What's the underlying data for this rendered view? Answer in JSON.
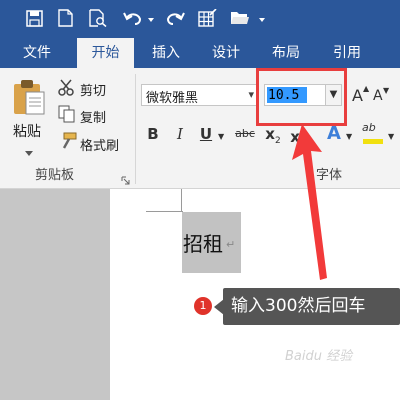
{
  "quick_access": {
    "icons": [
      "save-icon",
      "new-document-icon",
      "print-preview-icon",
      "undo-icon",
      "redo-icon",
      "table-icon",
      "open-folder-icon"
    ]
  },
  "tabs": [
    {
      "label": "文件",
      "active": false
    },
    {
      "label": "开始",
      "active": true
    },
    {
      "label": "插入",
      "active": false
    },
    {
      "label": "设计",
      "active": false
    },
    {
      "label": "布局",
      "active": false
    },
    {
      "label": "引用",
      "active": false
    }
  ],
  "clipboard": {
    "paste_label": "粘贴",
    "cut_label": "剪切",
    "copy_label": "复制",
    "format_painter_label": "格式刷",
    "group_label": "剪贴板"
  },
  "font": {
    "name": "微软雅黑",
    "size": "10.5",
    "group_label": "字体",
    "grow_label": "A",
    "shrink_label": "A",
    "bold": "B",
    "italic": "I",
    "underline": "U",
    "strikethrough": "abc",
    "subscript_base": "x",
    "subscript": "2",
    "superscript_base": "x",
    "superscript": "2",
    "text_effect": "A",
    "highlight": "ab"
  },
  "document": {
    "text": "招租",
    "paragraph_mark": "↵"
  },
  "annotation": {
    "step_number": "1",
    "text": "输入300然后回车"
  },
  "colors": {
    "accent": "#2b579a",
    "highlight_red": "#e83e3e",
    "annotation_bg": "#555555"
  }
}
